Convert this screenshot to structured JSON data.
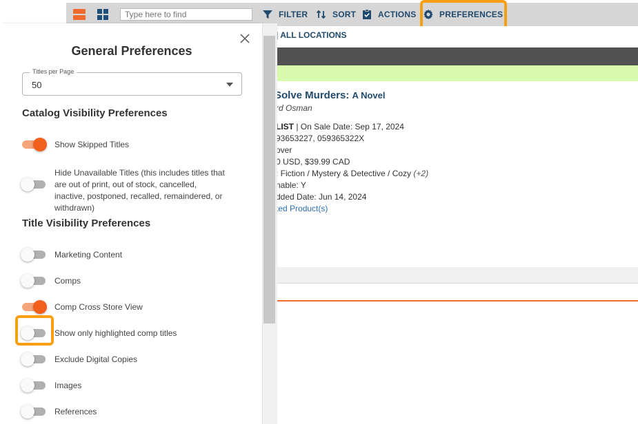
{
  "toolbar": {
    "search_placeholder": "Type here to find",
    "filter_label": "FILTER",
    "sort_label": "SORT",
    "actions_label": "ACTIONS",
    "preferences_label": "PREFERENCES"
  },
  "background": {
    "locations_text": "| ALL LOCATIONS",
    "book": {
      "title": "Solve Murders:",
      "subtitle": "A Novel",
      "author": "rd Osman",
      "list_label": "LIST",
      "on_sale": "| On Sale Date: Sep 17, 2024",
      "isbns": "93653227, 059365322X",
      "format": "over",
      "price": "0 USD, $39.99 CAD",
      "subject": ": Fiction / Mystery & Detective / Cozy",
      "subject_more": "(+2)",
      "returnable": "nable: Y",
      "added_date": "dded Date: Jun 14, 2024",
      "related_link": "ted Product(s)"
    }
  },
  "panel": {
    "title": "General Preferences",
    "titles_per_page": {
      "label": "Titles per Page",
      "value": "50"
    },
    "catalog_section": "Catalog Visibility Preferences",
    "title_section": "Title Visibility Preferences",
    "catalog_prefs": [
      {
        "label": "Show Skipped Titles",
        "on": true
      },
      {
        "label": "Hide Unavailable Titles (this includes titles that are out of print, out of stock, cancelled, inactive, postponed, recalled, remaindered, or withdrawn)",
        "on": false
      }
    ],
    "title_prefs": [
      {
        "label": "Marketing Content",
        "on": false
      },
      {
        "label": "Comps",
        "on": false
      },
      {
        "label": "Comp Cross Store View",
        "on": true
      },
      {
        "label": "Show only highlighted comp titles",
        "on": false
      },
      {
        "label": "Exclude Digital Copies",
        "on": false
      },
      {
        "label": "Images",
        "on": false
      },
      {
        "label": "References",
        "on": false
      }
    ]
  },
  "colors": {
    "accent_orange": "#f15f1f",
    "highlight_orange": "#f59f12",
    "navy": "#1f4a6e"
  }
}
